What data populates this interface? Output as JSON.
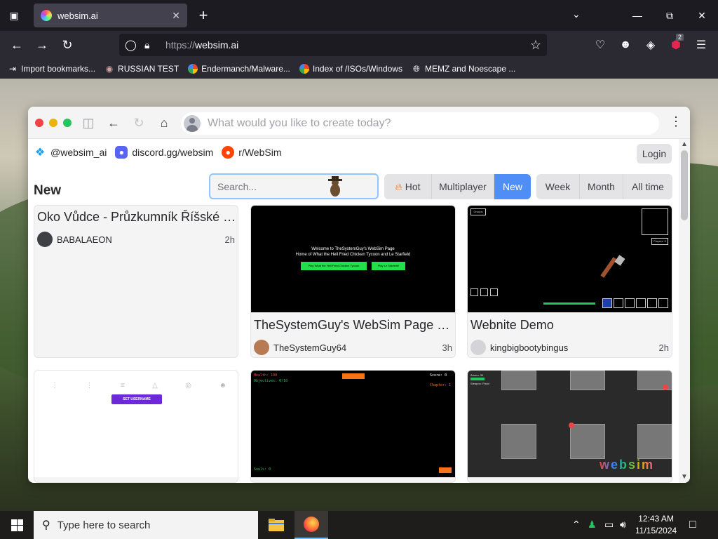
{
  "browser": {
    "tab_title": "websim.ai",
    "url_proto": "https://",
    "url_host": "websim.ai",
    "extension_badge": "2",
    "bookmarks": [
      {
        "label": "Import bookmarks...",
        "icon": "import-icon"
      },
      {
        "label": "RUSSIAN TEST",
        "icon": "github-icon"
      },
      {
        "label": "Endermanch/Malware...",
        "icon": "google-icon"
      },
      {
        "label": "Index of /ISOs/Windows",
        "icon": "google-icon"
      },
      {
        "label": "MEMZ and Noescape ...",
        "icon": "globe-icon"
      }
    ]
  },
  "websim": {
    "prompt_placeholder": "What would you like to create today?",
    "social": [
      {
        "label": "@websim_ai",
        "icon": "twitter-icon",
        "color": "#1d9bf0"
      },
      {
        "label": "discord.gg/websim",
        "icon": "discord-icon",
        "color": "#5865f2"
      },
      {
        "label": "r/WebSim",
        "icon": "reddit-icon",
        "color": "#ff4500"
      }
    ],
    "login_label": "Login",
    "section_title": "New",
    "search_placeholder": "Search...",
    "sort_options": [
      "Hot",
      "Multiplayer",
      "New"
    ],
    "active_sort": "New",
    "time_options": [
      "Week",
      "Month",
      "All time"
    ],
    "accent_color": "#4f8ef7",
    "cards": [
      {
        "title": "Oko Vůdce - Průzkumník Říšské D...",
        "author": "BABALAEON",
        "age": "2h"
      },
      {
        "title": "TheSystemGuy's WebSim Page (T...",
        "author": "TheSystemGuy64",
        "age": "3h",
        "thumb_heading": "Welcome to TheSystemGuy's WebSim Page",
        "thumb_sub": "Home of What the Hell Fried Chicken Tycoon and Le Starfield",
        "thumb_btn1": "Play What the Hell Fried Chicken Tycoon",
        "thumb_btn2": "Play Le Starfield!"
      },
      {
        "title": "Webnite Demo",
        "author": "kingbigbootybingus",
        "age": "2h",
        "thumb_tag": "Groups",
        "thumb_btn": "Players: 0"
      },
      {
        "set_username": "SET USERNAME"
      },
      {
        "health": "Health: 100",
        "objectives": "Objectives: 0/10",
        "score": "Score: 0",
        "chapter": "Chapter: 1",
        "souls": "Souls: 0"
      },
      {
        "ammo": "Ammo: 30",
        "weapon": "Weapon: Pistol",
        "watermark": "websim"
      }
    ]
  },
  "taskbar": {
    "search_placeholder": "Type here to search",
    "time": "12:43 AM",
    "date": "11/15/2024"
  }
}
